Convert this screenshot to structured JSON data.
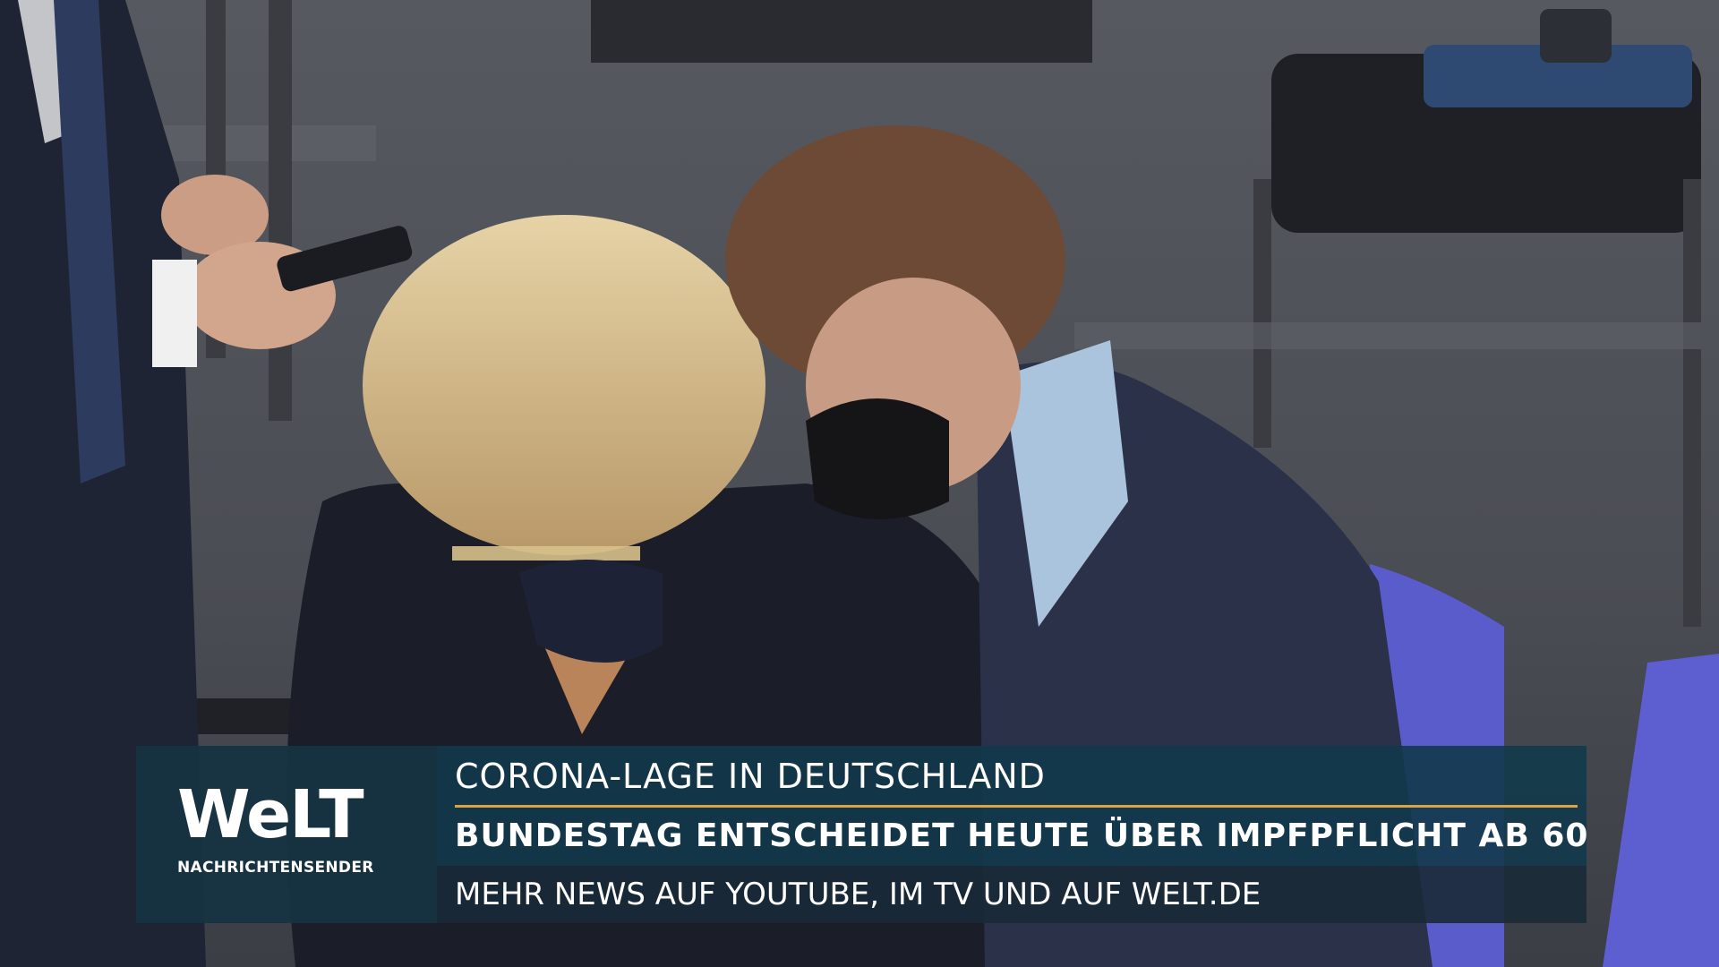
{
  "brand": {
    "logo_text": "WeLT",
    "logo_subtitle": "NACHRICHTENSENDER",
    "panel_color": "#163342",
    "accent_color": "#d9a441"
  },
  "lower_third": {
    "topic": "CORONA-LAGE IN DEUTSCHLAND",
    "headline": "BUNDESTAG ENTSCHEIDET HEUTE ÜBER IMPFPFLICHT AB 60",
    "ticker": "MEHR NEWS AUF YOUTUBE, IM TV UND AUF WELT.DE"
  }
}
